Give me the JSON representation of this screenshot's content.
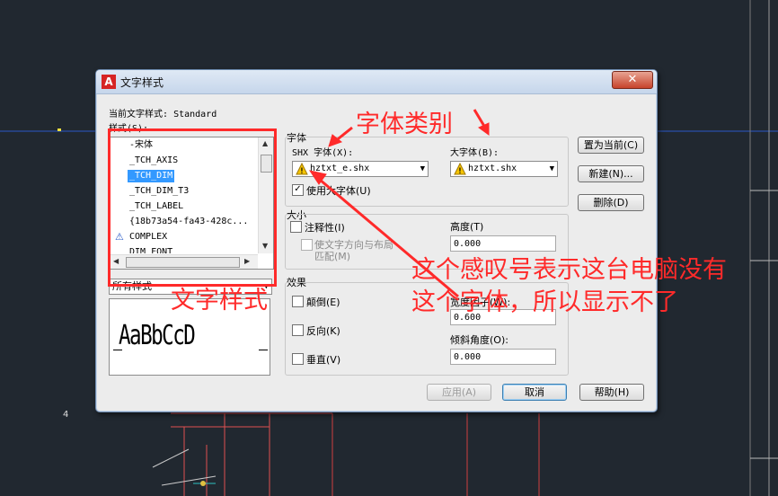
{
  "dialog": {
    "title": "文字样式",
    "current_style_label": "当前文字样式:",
    "current_style_value": "Standard",
    "styles_label": "样式(S):",
    "styles": [
      {
        "name": "-宋体",
        "icon": ""
      },
      {
        "name": "_TCH_AXIS",
        "icon": ""
      },
      {
        "name": "_TCH_DIM",
        "icon": "",
        "selected": true
      },
      {
        "name": "_TCH_DIM_T3",
        "icon": ""
      },
      {
        "name": "_TCH_LABEL",
        "icon": ""
      },
      {
        "name": "{18b73a54-fa43-428c...",
        "icon": ""
      },
      {
        "name": "COMPLEX",
        "icon": "annotative-icon"
      },
      {
        "name": "DIM_FONT",
        "icon": ""
      }
    ],
    "filter_value": "所有样式",
    "preview_text": "AaBbCcD",
    "font_group": {
      "label": "字体",
      "shx_font_label": "SHX 字体(X):",
      "shx_font_value": "hztxt_e.shx",
      "big_font_label": "大字体(B):",
      "big_font_value": "hztxt.shx",
      "use_big_font_label": "使用大字体(U)",
      "use_big_font_checked": true
    },
    "size_group": {
      "label": "大小",
      "annotative_label": "注释性(I)",
      "match_orientation_label_1": "使文字方向与布局",
      "match_orientation_label_2": "匹配(M)",
      "height_label": "高度(T)",
      "height_value": "0.000"
    },
    "effects_group": {
      "label": "效果",
      "upside_down_label": "颠倒(E)",
      "backwards_label": "反向(K)",
      "vertical_label": "垂直(V)",
      "width_factor_label": "宽度因子(W):",
      "width_factor_value": "0.600",
      "oblique_label": "倾斜角度(O):",
      "oblique_value": "0.000"
    },
    "buttons": {
      "set_current": "置为当前(C)",
      "new": "新建(N)...",
      "delete": "删除(D)",
      "apply": "应用(A)",
      "cancel": "取消",
      "help": "帮助(H)"
    }
  },
  "annotations": {
    "font_type": "字体类别",
    "text_style": "文字样式",
    "note_line1": "这个感叹号表示这台电脑没有",
    "note_line2": "这个字体，所以显示不了"
  },
  "colors": {
    "annotation": "#ff2a2a",
    "selection": "#3399ff",
    "cad_background": "#212830"
  }
}
